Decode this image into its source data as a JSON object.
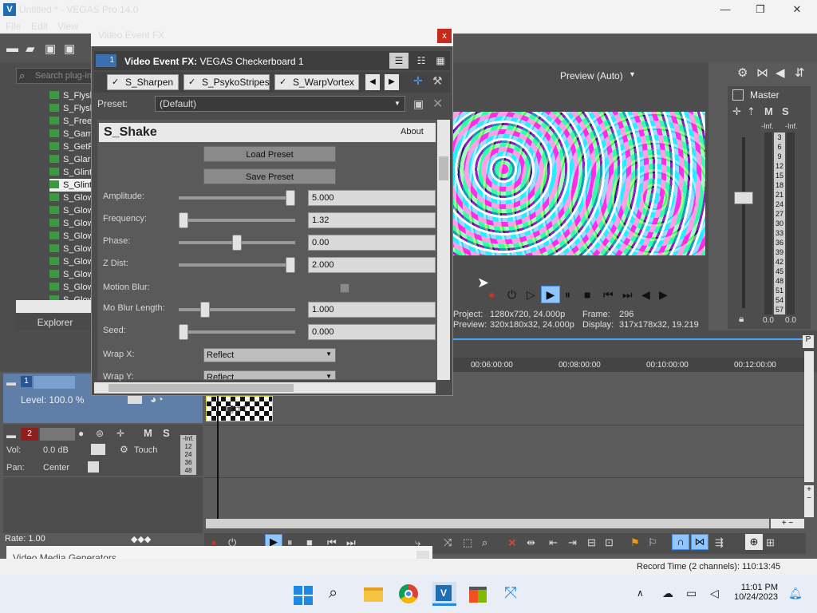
{
  "window": {
    "title": "Untitled * - VEGAS Pro 14.0",
    "logo": "V",
    "minimize": "—",
    "restore": "❐",
    "close": "✕"
  },
  "menu": [
    "File",
    "Edit",
    "View"
  ],
  "explorer": {
    "search_placeholder": "Search plug-in",
    "items": [
      "S_Flysl",
      "S_Flysl",
      "S_Free",
      "S_Gam",
      "S_GetF",
      "S_Glar",
      "S_Glint",
      "S_Glint",
      "S_Glow",
      "S_Glow",
      "S_Glow",
      "S_Glow",
      "S_Glow",
      "S_Glow",
      "S_Glow",
      "S_Glow",
      "S_Glow"
    ],
    "selected_index": 7,
    "tab": "Explorer"
  },
  "fx_dialog": {
    "title": "Video Event FX",
    "close": "x",
    "chain_number": "1",
    "chain_label_bold": "Video Event FX:",
    "chain_label_value": "VEGAS Checkerboard 1",
    "plugins": [
      "S_Sharpen",
      "S_PsykoStripes",
      "S_WarpVortex"
    ],
    "preset_label": "Preset:",
    "preset_value": "(Default)",
    "plugin_name": "S_Shake",
    "about": "About",
    "load_preset": "Load Preset",
    "save_preset": "Save Preset",
    "params": [
      {
        "label": "Amplitude:",
        "value": "5.000",
        "pos": 1.0
      },
      {
        "label": "Frequency:",
        "value": "1.32",
        "pos": 0.0
      },
      {
        "label": "Phase:",
        "value": "0.00",
        "pos": 0.5
      },
      {
        "label": "Z Dist:",
        "value": "2.000",
        "pos": 1.0
      }
    ],
    "motion_blur_label": "Motion Blur:",
    "params2": [
      {
        "label": "Mo Blur Length:",
        "value": "1.000",
        "pos": 0.2
      },
      {
        "label": "Seed:",
        "value": "0.000",
        "pos": 0.0
      }
    ],
    "wrap_x_label": "Wrap X:",
    "wrap_x_value": "Reflect",
    "wrap_y_label": "Wrap Y:",
    "wrap_y_value": "Reflect"
  },
  "preview": {
    "mode": "Preview (Auto)",
    "project_label": "Project:",
    "project_value": "1280x720, 24.000p",
    "preview_label": "Preview:",
    "preview_value": "320x180x32, 24.000p",
    "frame_label": "Frame:",
    "frame_value": "296",
    "display_label": "Display:",
    "display_value": "317x178x32, 19.219"
  },
  "master": {
    "title": "Master",
    "ms_m": "M",
    "ms_s": "S",
    "inf_l": "-Inf.",
    "inf_r": "-Inf.",
    "scale": [
      "3",
      "6",
      "9",
      "12",
      "15",
      "18",
      "21",
      "24",
      "27",
      "30",
      "33",
      "36",
      "39",
      "42",
      "45",
      "48",
      "51",
      "54",
      "57"
    ],
    "bottom_l": "0.0",
    "bottom_r": "0.0"
  },
  "timeline": {
    "ticks": [
      "00:06:00:00",
      "00:08:00:00",
      "00:10:00:00",
      "00:12:00:00"
    ],
    "track1_num": "1",
    "track1_level": "Level: 100.0 %",
    "track2_num": "2",
    "vol_label": "Vol:",
    "vol_value": "0.0 dB",
    "pan_label": "Pan:",
    "pan_value": "Center",
    "touch": "Touch",
    "track2_m": "M",
    "track2_s": "S",
    "mini_meter": [
      "-Inf.",
      "12",
      "24",
      "36",
      "48"
    ],
    "rate": "Rate: 1.00"
  },
  "status": {
    "record_time": "Record Time (2 channels): 110:13:45"
  },
  "generator_panel": {
    "title": "Video Media Generators"
  },
  "taskbar": {
    "time": "11:01 PM",
    "date": "10/24/2023"
  }
}
